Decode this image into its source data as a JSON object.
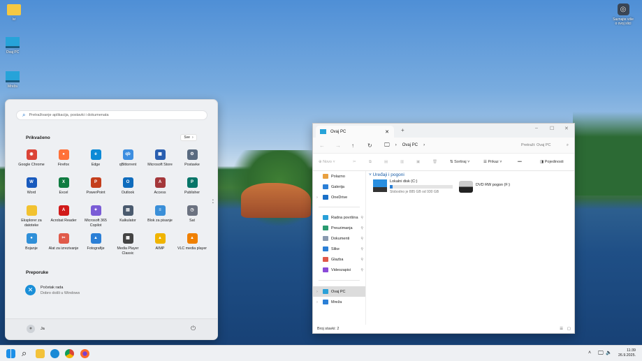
{
  "desktop": {
    "icons": [
      {
        "label": "Ivi",
        "icon": "folder-icon"
      },
      {
        "label": "Ovaj PC",
        "icon": "computer-icon"
      },
      {
        "label": "Mreža",
        "icon": "network-icon"
      }
    ],
    "spotlight": {
      "label_line1": "Saznajte više",
      "label_line2": "o ovoj slici",
      "icon": "camera-icon"
    }
  },
  "start_menu": {
    "search_placeholder": "Pretraživanje aplikacija, postavki i dokumenata",
    "pinned_title": "Prikvačeno",
    "all_label": "Sve",
    "apps": [
      {
        "label": "Google Chrome",
        "color": "#db4437",
        "glyph": "◉"
      },
      {
        "label": "Firefox",
        "color": "#ff7139",
        "glyph": "●"
      },
      {
        "label": "Edge",
        "color": "#0c8ad6",
        "glyph": "e"
      },
      {
        "label": "qBittorrent",
        "color": "#3d8ee0",
        "glyph": "qb"
      },
      {
        "label": "Microsoft Store",
        "color": "#2a5fb0",
        "glyph": "▦"
      },
      {
        "label": "Postavke",
        "color": "#5a6b80",
        "glyph": "⚙"
      },
      {
        "label": "Word",
        "color": "#185abd",
        "glyph": "W"
      },
      {
        "label": "Excel",
        "color": "#107c41",
        "glyph": "X"
      },
      {
        "label": "PowerPoint",
        "color": "#c43e1c",
        "glyph": "P"
      },
      {
        "label": "Outlook",
        "color": "#0f6cbd",
        "glyph": "O"
      },
      {
        "label": "Access",
        "color": "#a4373a",
        "glyph": "A"
      },
      {
        "label": "Publisher",
        "color": "#077568",
        "glyph": "P"
      },
      {
        "label": "Eksplorer za datoteke",
        "color": "#f2c230",
        "glyph": ""
      },
      {
        "label": "Acrobat Reader",
        "color": "#d11a1a",
        "glyph": "A"
      },
      {
        "label": "Microsoft 365 Copilot",
        "color": "#7a5cd6",
        "glyph": "✦"
      },
      {
        "label": "Kalkulator",
        "color": "#4a5a6e",
        "glyph": "▤"
      },
      {
        "label": "Blok za pisanje",
        "color": "#3a8fd8",
        "glyph": "≡"
      },
      {
        "label": "Sat",
        "color": "#6b7280",
        "glyph": "◷"
      },
      {
        "label": "Bojanje",
        "color": "#2f8fd8",
        "glyph": "●"
      },
      {
        "label": "Alat za izrezivanje",
        "color": "#e05a4a",
        "glyph": "✂"
      },
      {
        "label": "Fotografije",
        "color": "#2b7fd6",
        "glyph": "▲"
      },
      {
        "label": "Media Player Classic",
        "color": "#444",
        "glyph": "▦"
      },
      {
        "label": "AIMP",
        "color": "#f0b400",
        "glyph": "▲"
      },
      {
        "label": "VLC media player",
        "color": "#f08000",
        "glyph": "▲"
      }
    ],
    "recommended_title": "Preporuke",
    "recommended": [
      {
        "title": "Početak rada",
        "subtitle": "Dobro došli u Windows"
      }
    ],
    "user_name": "Ja"
  },
  "explorer": {
    "tab_title": "Ovaj PC",
    "breadcrumb": [
      "Ovaj PC"
    ],
    "search_placeholder": "Pretraži: Ovaj PC",
    "toolbar": {
      "new": "Novo",
      "sort": "Sortiraj",
      "view": "Prikaz",
      "more": "•••",
      "details": "Pojedinosti"
    },
    "nav_top": [
      {
        "label": "Polazno",
        "color": "#e8a040"
      },
      {
        "label": "Galerija",
        "color": "#2b7fd6"
      },
      {
        "label": "OneDrive",
        "color": "#1a70c8"
      }
    ],
    "nav_pinned": [
      {
        "label": "Radna površina",
        "color": "#2aa0d8"
      },
      {
        "label": "Preuzimanja",
        "color": "#2a9a70"
      },
      {
        "label": "Dokumenti",
        "color": "#8a9ab0"
      },
      {
        "label": "Slike",
        "color": "#2b7fd6"
      },
      {
        "label": "Glazba",
        "color": "#e0584a"
      },
      {
        "label": "Videozapisi",
        "color": "#8a4ad8"
      }
    ],
    "nav_bottom": [
      {
        "label": "Ovaj PC",
        "color": "#2aa0d8"
      },
      {
        "label": "Mreža",
        "color": "#2b7fd6"
      }
    ],
    "section_title": "Uređaji i pogoni",
    "drives": [
      {
        "name": "Lokalni disk (C:)",
        "free_text": "Slobodno je 885 GB od 930 GB",
        "used_fraction": 0.048
      },
      {
        "name": "DVD RW pogon (F:)"
      }
    ],
    "status": "Broj stavki: 2"
  },
  "taskbar": {
    "apps": [
      "start-icon",
      "search-icon",
      "file-explorer-icon",
      "edge-icon",
      "chrome-icon",
      "firefox-icon"
    ],
    "time": "11:39",
    "date": "26.9.2025."
  }
}
